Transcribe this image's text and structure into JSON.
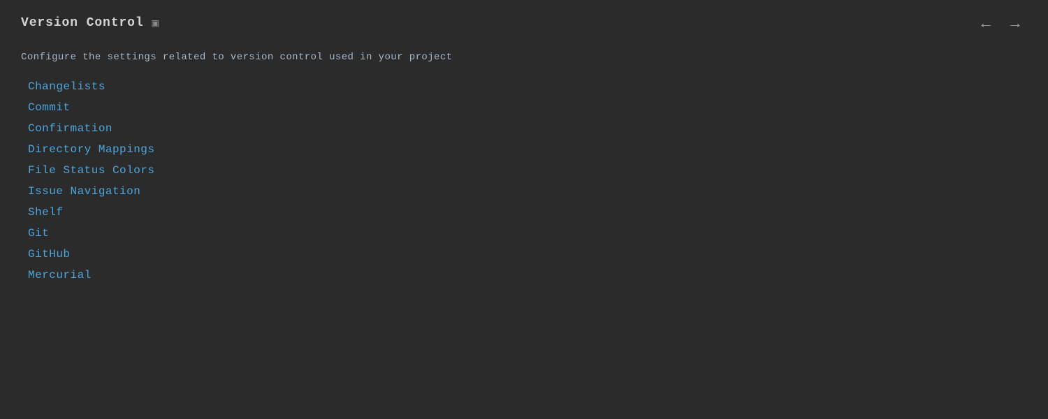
{
  "header": {
    "title": "Version Control",
    "window_icon": "▣",
    "nav_back": "←",
    "nav_forward": "→"
  },
  "description": "Configure the settings related to version control used in your project",
  "nav_items": [
    {
      "label": "Changelists"
    },
    {
      "label": "Commit"
    },
    {
      "label": "Confirmation"
    },
    {
      "label": "Directory Mappings"
    },
    {
      "label": "File Status Colors"
    },
    {
      "label": "Issue Navigation"
    },
    {
      "label": "Shelf"
    },
    {
      "label": "Git"
    },
    {
      "label": "GitHub"
    },
    {
      "label": "Mercurial"
    }
  ]
}
